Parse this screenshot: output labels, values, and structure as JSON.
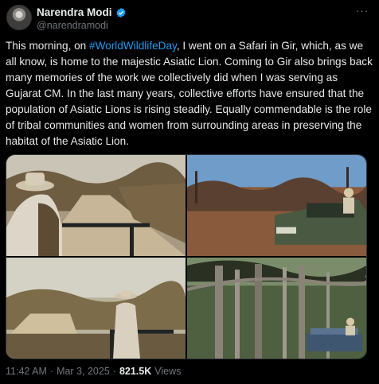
{
  "author": {
    "name": "Narendra Modi",
    "handle": "@narendramodi"
  },
  "post": {
    "text_before": "This morning, on ",
    "hashtag": "#WorldWildlifeDay",
    "text_after": ", I went on a Safari in Gir, which, as we all know, is home to the majestic Asiatic Lion. Coming to Gir also brings back many memories of the work we collectively did when I was serving as Gujarat CM. In the last many years, collective efforts have ensured that the population of Asiatic Lions is rising steadily. Equally commendable is the role of tribal communities and women from surrounding areas in preserving the habitat of the Asiatic Lion."
  },
  "meta": {
    "time": "11:42 AM",
    "sep1": "·",
    "date": "Mar 3, 2025",
    "sep2": "·",
    "views_count": "821.5K",
    "views_label": "Views"
  },
  "colors": {
    "background": "#000000",
    "text": "#e7e9ea",
    "muted": "#71767b",
    "link": "#1d9bf0",
    "verified": "#1d9bf0"
  },
  "icons": [
    "verified-badge-icon",
    "more-options-icon"
  ]
}
